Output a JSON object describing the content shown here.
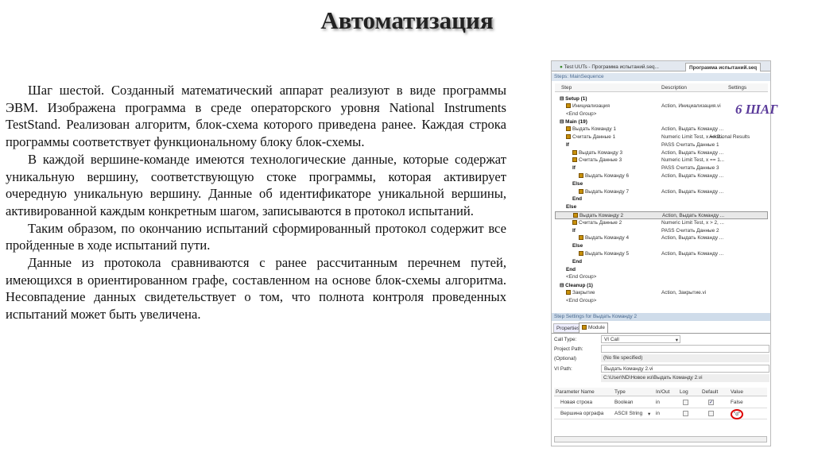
{
  "title": "Автоматизация",
  "paragraphs": [
    "Шаг шестой. Созданный математический аппарат реализуют в виде программы ЭВМ. Изображена программа  в среде операторского уровня National Instruments TestStand. Реализован алгоритм, блок-схема которого приведена ранее. Каждая строка программы соответствует функциональному блоку блок-схемы.",
    "В каждой вершине-команде имеются технологические данные, которые содержат уникальную вершину, соответствующую стоке программы, которая активирует очередную уникальную вершину. Данные об идентификаторе уникальной вершины, активированной каждым конкретным шагом, записываются в протокол испытаний.",
    "Таким образом, по окончанию испытаний сформированный протокол содержит все пройденные в ходе испытаний пути.",
    "Данные из протокола сравниваются с ранее рассчитанным перечнем путей, имеющихся в ориентированном графе, составленном на основе блок-схемы алгоритма. Несовпадение данных свидетельствует о том, что полнота контроля проведенных испытаний может быть увеличена."
  ],
  "annotation": "6 ШАГ",
  "app": {
    "tabs": [
      "Test UUTs - Программа испытаний.seq...",
      "Программа испытаний.seq"
    ],
    "steps_bar": "Steps: MainSequence",
    "columns": [
      "Step",
      "Description",
      "Settings"
    ],
    "rows": [
      {
        "label": "Setup (1)",
        "desc": "",
        "set": "",
        "bold": true,
        "lvl": 0,
        "icon": false
      },
      {
        "label": "Инициализация",
        "desc": "Action,  Инициализация.vi",
        "set": "",
        "lvl": 1,
        "icon": true
      },
      {
        "label": "<End Group>",
        "desc": "",
        "set": "",
        "lvl": 1
      },
      {
        "label": "Main (19)",
        "desc": "",
        "set": "",
        "bold": true,
        "lvl": 0
      },
      {
        "label": "Выдать Команду 1",
        "desc": "Action,  Выдать Команду ...",
        "set": "",
        "lvl": 1,
        "icon": true
      },
      {
        "label": "Считать Данные 1",
        "desc": "Numeric Limit Test,  x == 2...",
        "set": "Additional Results",
        "lvl": 1,
        "icon": true
      },
      {
        "label": "If",
        "desc": "PASS Считать Данные 1",
        "set": "",
        "bold": true,
        "lvl": 1
      },
      {
        "label": "Выдать Команду 3",
        "desc": "Action,  Выдать Команду ...",
        "set": "",
        "lvl": 2,
        "icon": true
      },
      {
        "label": "Считать Данные 3",
        "desc": "Numeric Limit Test,  x == 1...",
        "set": "",
        "lvl": 2,
        "icon": true
      },
      {
        "label": "If",
        "desc": "PASS Считать Данные 3",
        "set": "",
        "bold": true,
        "lvl": 2
      },
      {
        "label": "Выдать Команду 6",
        "desc": "Action,  Выдать Команду ...",
        "set": "",
        "lvl": 3,
        "icon": true
      },
      {
        "label": "Else",
        "desc": "",
        "set": "",
        "bold": true,
        "lvl": 2
      },
      {
        "label": "Выдать Команду 7",
        "desc": "Action,  Выдать Команду ...",
        "set": "",
        "lvl": 3,
        "icon": true
      },
      {
        "label": "End",
        "desc": "",
        "set": "",
        "bold": true,
        "lvl": 2
      },
      {
        "label": "Else",
        "desc": "",
        "set": "",
        "bold": true,
        "lvl": 1
      },
      {
        "label": "Выдать Команду 2",
        "desc": "Action,  Выдать Команду ...",
        "set": "",
        "lvl": 2,
        "icon": true,
        "sel": true
      },
      {
        "label": "Считать Данные 2",
        "desc": "Numeric Limit Test,  x > 2, ...",
        "set": "",
        "lvl": 2,
        "icon": true
      },
      {
        "label": "If",
        "desc": "PASS Считать Данные 2",
        "set": "",
        "bold": true,
        "lvl": 2
      },
      {
        "label": "Выдать Команду 4",
        "desc": "Action,  Выдать Команду ...",
        "set": "",
        "lvl": 3,
        "icon": true
      },
      {
        "label": "Else",
        "desc": "",
        "set": "",
        "bold": true,
        "lvl": 2
      },
      {
        "label": "Выдать Команду 5",
        "desc": "Action,  Выдать Команду ...",
        "set": "",
        "lvl": 3,
        "icon": true
      },
      {
        "label": "End",
        "desc": "",
        "set": "",
        "bold": true,
        "lvl": 2
      },
      {
        "label": "End",
        "desc": "",
        "set": "",
        "bold": true,
        "lvl": 1
      },
      {
        "label": "<End Group>",
        "desc": "",
        "set": "",
        "lvl": 1
      },
      {
        "label": "Cleanup (1)",
        "desc": "",
        "set": "",
        "bold": true,
        "lvl": 0
      },
      {
        "label": "Закрытие",
        "desc": "Action,  Закрытие.vi",
        "set": "",
        "lvl": 1,
        "icon": true
      },
      {
        "label": "<End Group>",
        "desc": "",
        "set": "",
        "lvl": 1
      }
    ],
    "settings_bar": "Step Settings for Выдать Команду 2",
    "settings_tabs": [
      "Properties",
      "Module"
    ],
    "call_type_label": "Call Type:",
    "call_type": "VI Call",
    "project_path_label": "Project Path:",
    "optional_label": "(Optional)",
    "project_path_info": "(No file specified)",
    "vi_path_label": "VI Path:",
    "vi_path": "Выдать Команду 2.vi",
    "vi_full_path": "C:\\User\\ND\\Новое из\\Выдать Команду 2.vi",
    "param_columns": [
      "Parameter Name",
      "Type",
      "In/Out",
      "Log",
      "Default",
      "Value"
    ],
    "params": [
      {
        "name": "Новая строка",
        "type": "Boolean",
        "inout": "in",
        "log": false,
        "default": true,
        "value": "False"
      },
      {
        "name": "Вершина орграфа",
        "type": "ASCII String",
        "inout": "in",
        "log": false,
        "default": false,
        "value": "\"d\""
      }
    ]
  }
}
